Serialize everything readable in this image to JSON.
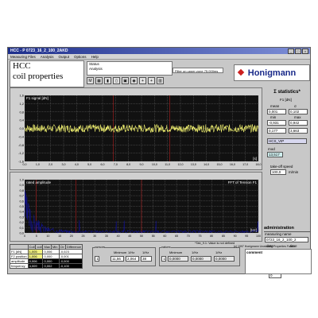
{
  "window": {
    "title": "HCC - P 0723_16_2_100_2AKD",
    "menu": [
      "Measuring Files",
      "Analysis",
      "Output",
      "Options",
      "Help"
    ]
  },
  "header": {
    "app_name_line1": "HCC",
    "app_name_line2": "coil properties",
    "status_label": "Status",
    "status_value": "Analysis",
    "file_info": "Filter on upper zone 75,000ms",
    "brand": "Honigmann"
  },
  "toolbar": {
    "buttons": [
      {
        "name": "measure-button",
        "glyph": "M"
      },
      {
        "name": "print-button",
        "glyph": "▦"
      },
      {
        "name": "statistics-button",
        "glyph": "▮"
      },
      {
        "name": "histogram-button",
        "glyph": "▯"
      },
      {
        "name": "save-button",
        "glyph": "▣"
      },
      {
        "name": "stop-button",
        "glyph": "◉"
      },
      {
        "name": "zoom-in-button",
        "glyph": "+"
      },
      {
        "name": "zoom-out-button",
        "glyph": "+"
      },
      {
        "name": "fit-button",
        "glyph": "▥"
      }
    ]
  },
  "plot_top": {
    "title": "F1 signal [dN]",
    "y_ticks": [
      "1,6",
      "1,2",
      "0,8",
      "0,4",
      "0,0",
      "-0,4",
      "-0,8",
      "-1,2",
      "-1,6"
    ],
    "x_ticks": [
      "0,0",
      "1,0",
      "2,0",
      "3,0",
      "4,0",
      "5,0",
      "6,0",
      "7,0",
      "8,0",
      "9,0",
      "10,0",
      "11,0",
      "12,0",
      "13,0",
      "14,0",
      "15,0",
      "16,0",
      "17,0",
      "18,0"
    ],
    "unit": "[s]",
    "colors": {
      "signal": "#f0f070",
      "grid": "#a0a0a0",
      "marker": "#d02020"
    }
  },
  "plot_bottom": {
    "title": "rated amplitude",
    "subtitle": "FFT of Tension F1",
    "y_ticks": [
      "1,0",
      "0,9",
      "0,8",
      "0,7",
      "0,6",
      "0,5",
      "0,4",
      "0,3",
      "0,2",
      "0,1",
      "0,0"
    ],
    "x_ticks": [
      "0",
      "5",
      "10",
      "15",
      "20",
      "25",
      "30",
      "35",
      "40",
      "45",
      "50",
      "55",
      "60",
      "65",
      "70",
      "75",
      "80",
      "85",
      "90",
      "95",
      "100"
    ],
    "unit": "[Hz]",
    "colors": {
      "signal": "#1010a0",
      "grid": "#a0a0a0",
      "marker": "#d02020"
    }
  },
  "statistics": {
    "title": "Σ statistics*",
    "unit": "F1 [dN]",
    "labels": {
      "mean": "mean",
      "sd": "σ",
      "min": "min",
      "max": "max"
    },
    "mean": "0,001",
    "sd": "0,102",
    "min": "-0,931",
    "max": "0,942",
    "row3_left": "0,177",
    "row3_right": "3,663",
    "channel_label": "HCS_VIP",
    "last_label": "mod",
    "last_value": "13,517",
    "speed_label": "take-off speed",
    "speed_value": "100,0",
    "speed_unit": "m/min"
  },
  "administration": {
    "title": "administration",
    "measuring_name_label": "measuring name",
    "measuring_name": "0723_16_2_100_2",
    "date_label": "date",
    "time_label": "time",
    "date": "5/18/01",
    "time": "4:43 PM",
    "user_label": "user",
    "user": "zone",
    "yarn_label": "yarn [dTex]",
    "yarn": "0",
    "comment_label": "comment"
  },
  "channel_table": {
    "headers": [
      "",
      "Coil",
      "coil",
      "Max",
      "Min",
      "Ctr",
      "Difference"
    ],
    "rows": [
      {
        "label": "F1 [dN]",
        "a": "1,005",
        "b": "0,006",
        "c": "-0,023"
      },
      {
        "label": "F2 position",
        "a": "1,006",
        "b": "0,000",
        "c": "-0,001"
      },
      {
        "label": "amplitude",
        "a": "0,006",
        "b": "0,000",
        "c": "-0,000"
      },
      {
        "label": "frequency",
        "a": "4,009",
        "b": "0,002",
        "c": "-0,100"
      }
    ]
  },
  "bottom_groups": {
    "cursors_title": "cursors",
    "values_title": "values",
    "cursor_minimum_label": "Minimum",
    "cursor_min_value": "11,56",
    "cursor_b_label": "1/Hz",
    "cursor_b_value": "2,064",
    "cursor_c_label": "1/Hz",
    "cursor_c_value": "38",
    "values_minimum_label": "Minimum",
    "values_a_label": "1/Hz",
    "values_b_label": "1/Hz",
    "value_a": "0,0000",
    "value_b": "0,0000",
    "value_c": "0,0000",
    "note": "*Tab_9.1: Value is not defined",
    "copyright": "(c) 1997 Honigmann Unwinding Properties Factor"
  }
}
